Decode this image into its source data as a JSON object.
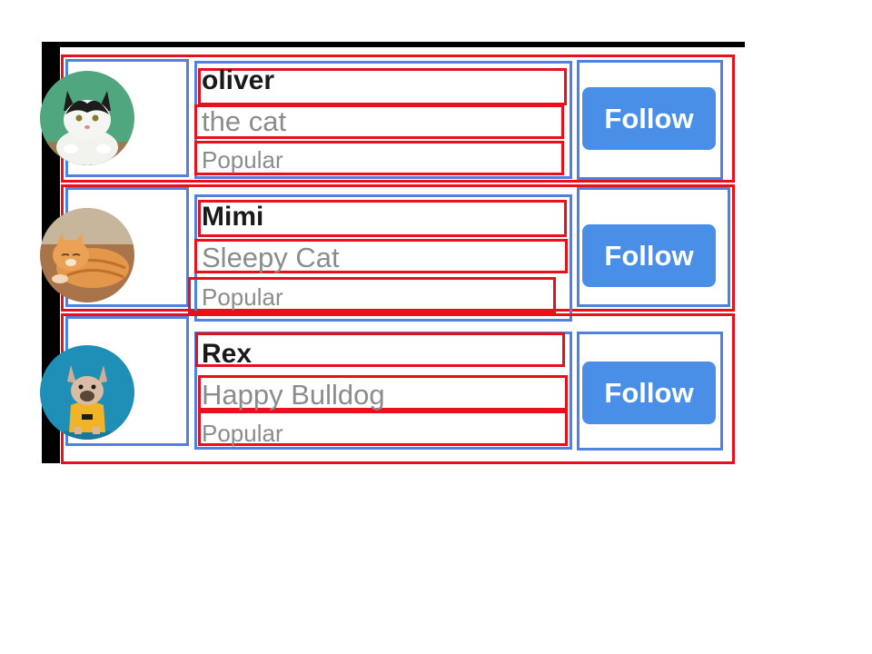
{
  "users": [
    {
      "name": "oliver",
      "tagline": "the cat",
      "badge": "Popular",
      "button_label": "Follow",
      "avatar_icon": "cat-icon",
      "avatar_bg": "#4fa67f"
    },
    {
      "name": "Mimi",
      "tagline": "Sleepy Cat",
      "badge": "Popular",
      "button_label": "Follow",
      "avatar_icon": "cat-icon",
      "avatar_bg": "#a9744a"
    },
    {
      "name": "Rex",
      "tagline": "Happy Bulldog",
      "badge": "Popular",
      "button_label": "Follow",
      "avatar_icon": "dog-icon",
      "avatar_bg": "#1f8fb7"
    }
  ],
  "colors": {
    "button": "#4a8fe7",
    "outline_red": "#e8101b",
    "outline_blue": "#4f82e0"
  }
}
